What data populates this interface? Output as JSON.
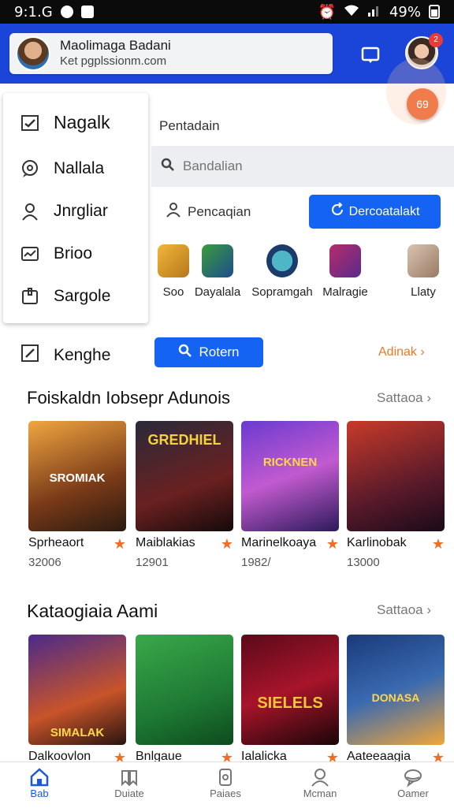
{
  "status_bar": {
    "time": "9:1.G",
    "battery": "49%"
  },
  "account": {
    "name": "Maolimaga Badani",
    "email": "Ket pgplssionm.com",
    "badge": "2"
  },
  "fab": {
    "label": "69"
  },
  "drawer": {
    "items": [
      {
        "label": "Nagalk",
        "icon": "check-square-icon"
      },
      {
        "label": "Nallala",
        "icon": "eye-chat-icon"
      },
      {
        "label": "Jnrgliar",
        "icon": "person-icon"
      },
      {
        "label": "Brioo",
        "icon": "chart-card-icon"
      },
      {
        "label": "Sargole",
        "icon": "locker-icon"
      }
    ],
    "separate_item": {
      "label": "Kenghe",
      "icon": "edit-square-icon"
    }
  },
  "search": {
    "label": "Pentadain",
    "placeholder": "Bandalian"
  },
  "people_row": {
    "label": "Pencaqian"
  },
  "primary_button": {
    "label": "Dercoatalakt"
  },
  "categories": [
    {
      "label": "Soo"
    },
    {
      "label": "Dayalala"
    },
    {
      "label": "Sopramgah"
    },
    {
      "label": "Malragie"
    },
    {
      "label": "Llaty"
    }
  ],
  "find_button": {
    "label": "Rotern"
  },
  "orange_link": {
    "label": "Adinak"
  },
  "section1": {
    "title": "Foiskaldn Iobsepr Adunois",
    "see_all": "Sattaoa",
    "cards": [
      {
        "name": "Sprheaort",
        "count": "32006",
        "art_text": "SROMIAK"
      },
      {
        "name": "Maiblakias",
        "count": "12901",
        "art_text": "GREDHIEL"
      },
      {
        "name": "Marinelkoaya",
        "count": "1982/",
        "art_text": "RICKNEN"
      },
      {
        "name": "Karlinobak",
        "count": "13000",
        "art_text": ""
      }
    ]
  },
  "section2": {
    "title": "Kataogiaia Aami",
    "see_all": "Sattaoa",
    "cards": [
      {
        "name": "Dalkoovlon",
        "art_text": "SIMALAK"
      },
      {
        "name": "Bnlgaue",
        "art_text": ""
      },
      {
        "name": "Ialalicka",
        "art_text": "SIELELS"
      },
      {
        "name": "Aateeaagia",
        "art_text": "DONASA"
      }
    ]
  },
  "bottom_nav": {
    "items": [
      {
        "label": "Bab",
        "icon": "home-icon",
        "active": true
      },
      {
        "label": "Duiate",
        "icon": "bookmark-icon",
        "active": false
      },
      {
        "label": "Paiaes",
        "icon": "phone-icon",
        "active": false
      },
      {
        "label": "Mcman",
        "icon": "person-icon",
        "active": false
      },
      {
        "label": "Oamer",
        "icon": "chat-icon",
        "active": false
      }
    ]
  },
  "colors": {
    "app_bar": "#1a45d8",
    "accent": "#1463f3",
    "orange": "#f06d22",
    "nav_active": "#1a58e0"
  }
}
